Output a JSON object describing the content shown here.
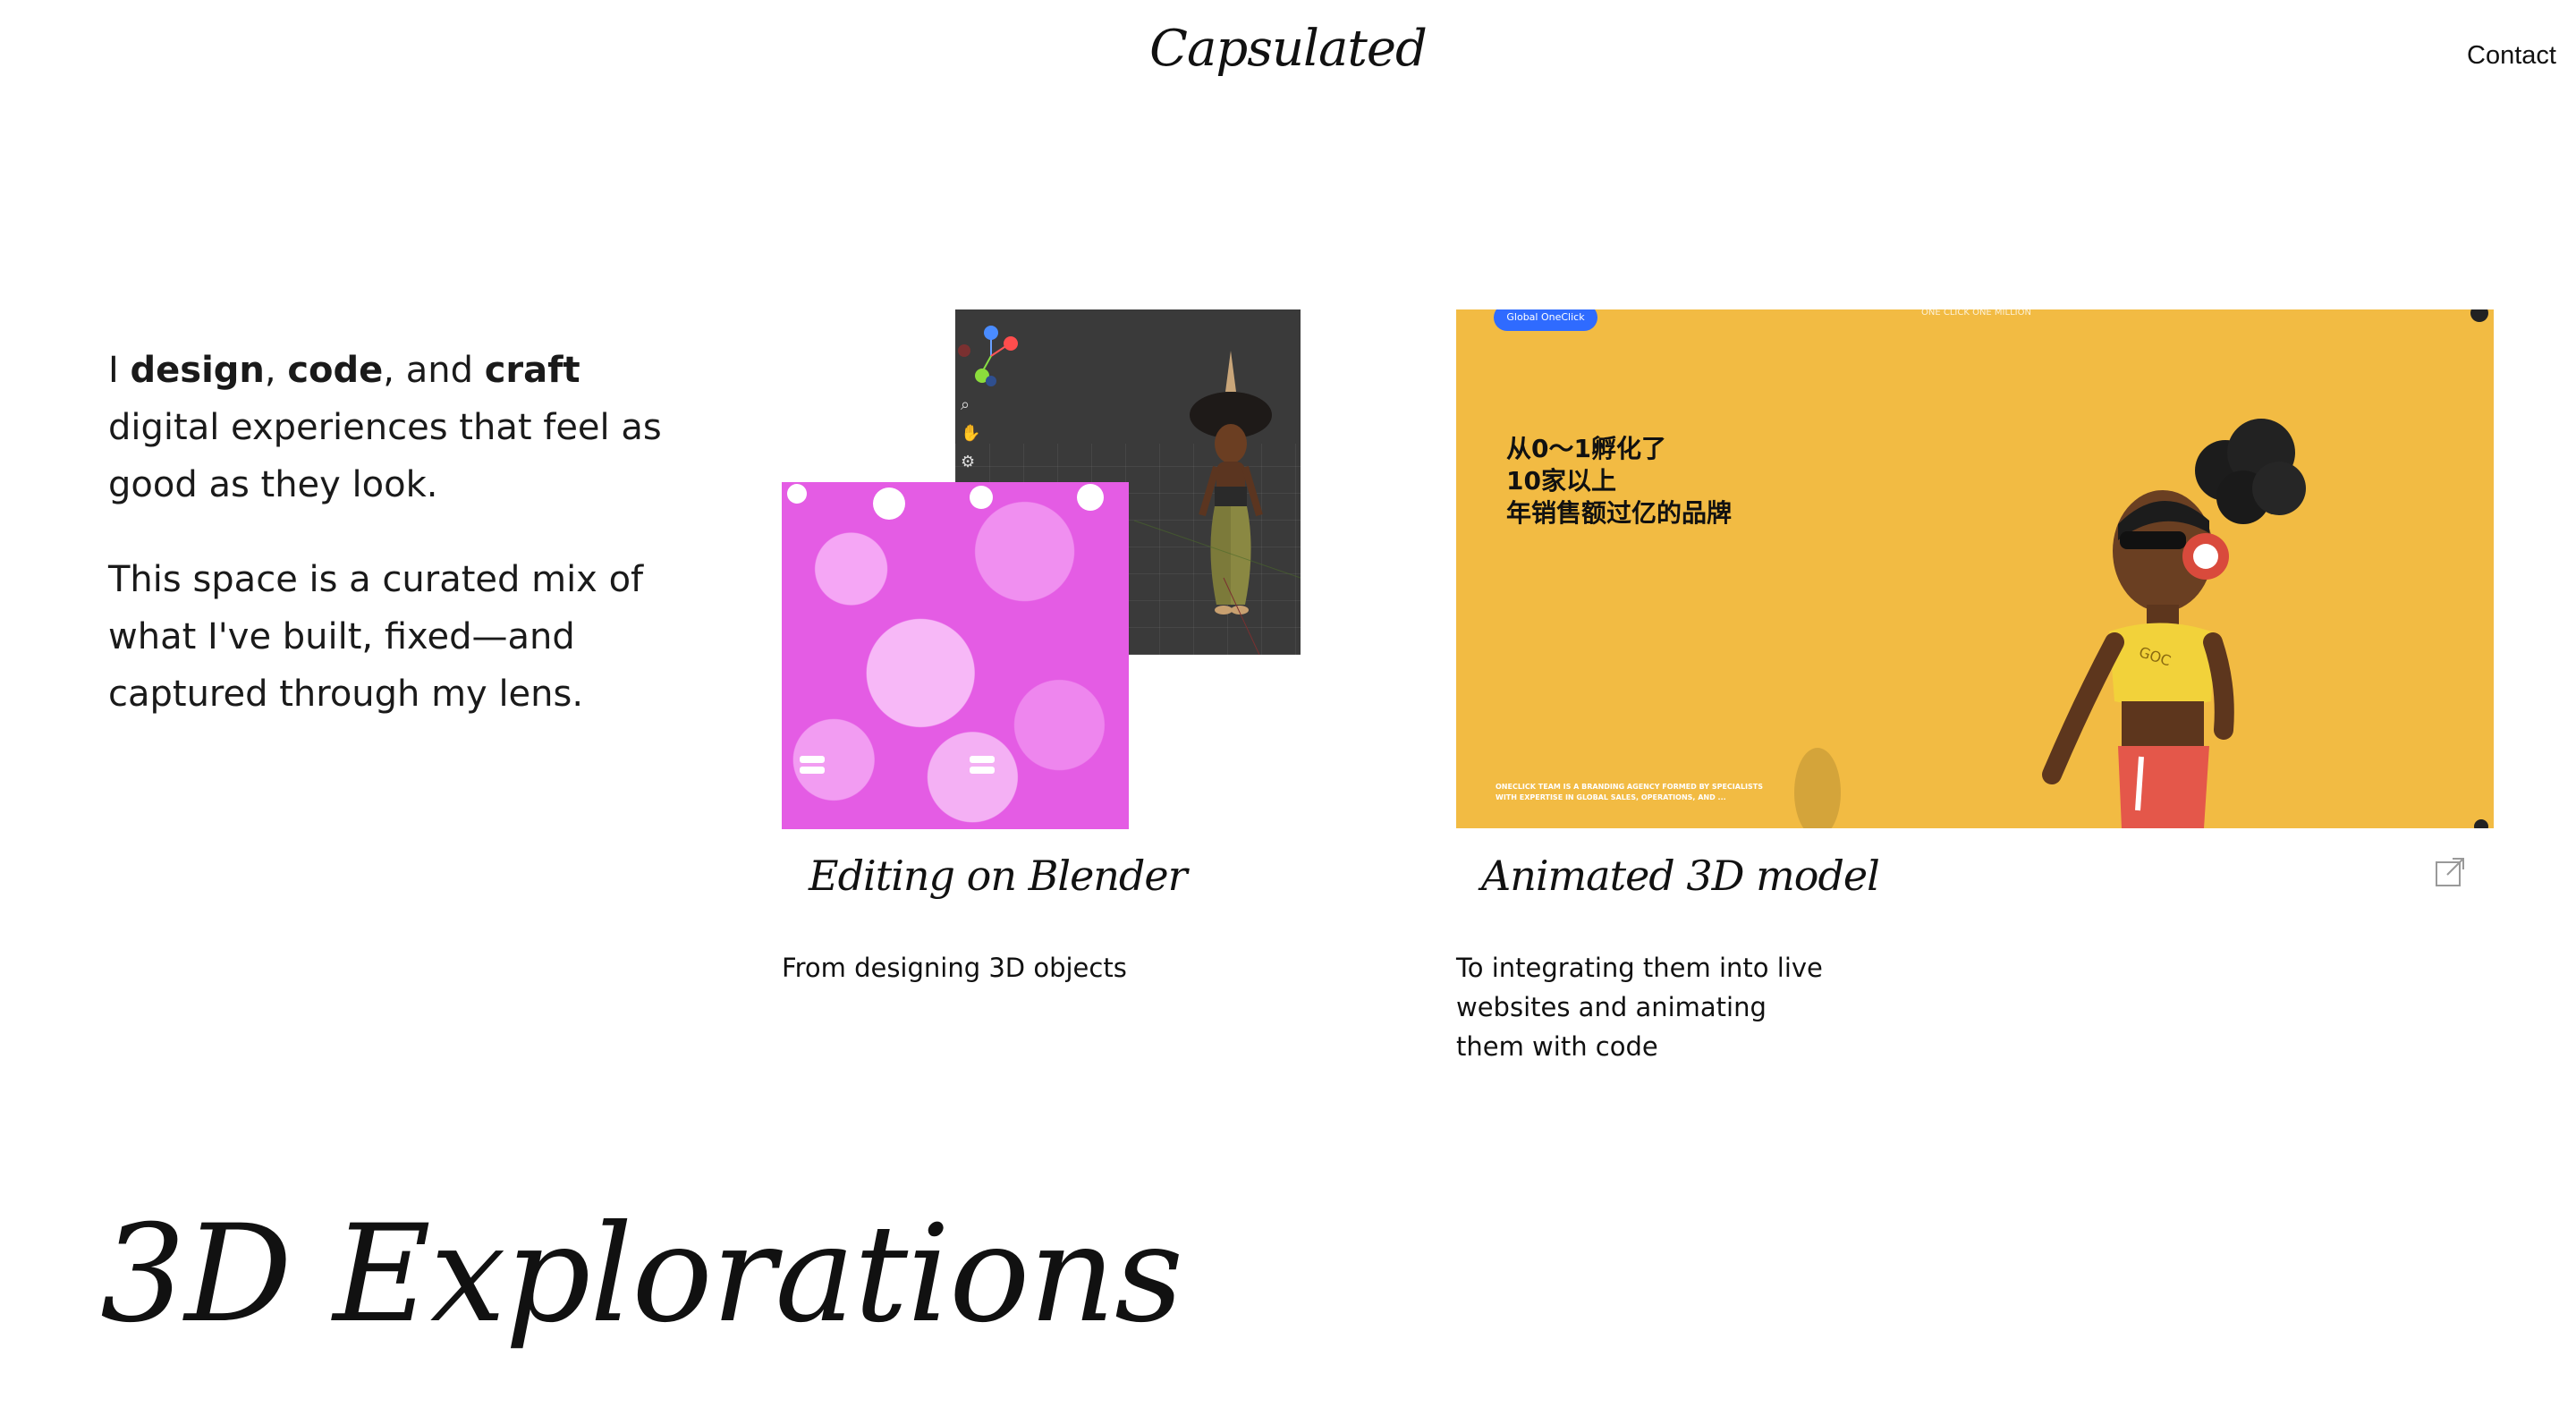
{
  "header": {
    "logo": "Capsulated",
    "contact": "Contact"
  },
  "intro": {
    "p1_prefix": "I ",
    "p1_b1": "design",
    "p1_sep1": ", ",
    "p1_b2": "code",
    "p1_sep2": ", and ",
    "p1_b3": "craft",
    "p1_rest": " digital experiences that feel as good as they look.",
    "p2": "This space is a curated mix of what I've built, fixed—and captured through my lens."
  },
  "projects": [
    {
      "title": "Editing on Blender",
      "description": "From designing 3D objects"
    },
    {
      "title": "Animated 3D model",
      "description": "To integrating them into live websites and animating them with code"
    }
  ],
  "animated_shot": {
    "badge": "Global OneClick",
    "top_text": "ONE CLICK ONE MILLION",
    "headline": [
      "从0～1孵化了",
      "10家以上",
      "年销售额过亿的品牌"
    ],
    "small_copy": "ONECLICK TEAM IS A BRANDING AGENCY FORMED BY SPECIALISTS WITH EXPERTISE IN GLOBAL SALES, OPERATIONS, AND ...",
    "shirt_text": "GOC"
  },
  "section": {
    "title": "3D Explorations"
  },
  "colors": {
    "background": "#ffffff",
    "yellow": "#f2bb43",
    "magenta": "#e45ce4",
    "viewport": "#3a3a3a"
  }
}
